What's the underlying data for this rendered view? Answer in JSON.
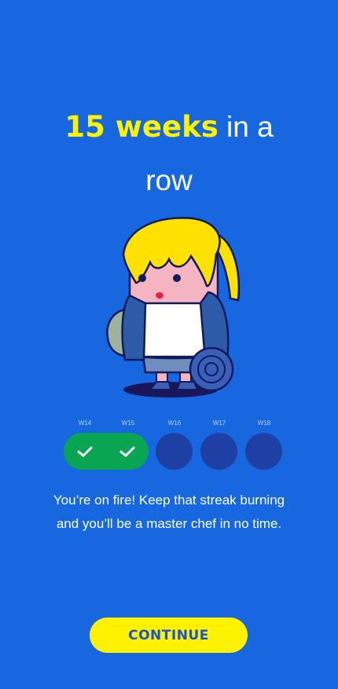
{
  "headline": {
    "highlight": "15 weeks",
    "rest": " in a",
    "line2": "row"
  },
  "illustration": {
    "icon": "character-with-rolled-mat-illustration"
  },
  "weeks": [
    {
      "label": "W14",
      "completed": true
    },
    {
      "label": "W15",
      "completed": true
    },
    {
      "label": "W16",
      "completed": false
    },
    {
      "label": "W17",
      "completed": false
    },
    {
      "label": "W18",
      "completed": false
    }
  ],
  "message": {
    "line1": "You’re on fire! Keep that streak burning",
    "line2": "and you’ll be a master chef in no time."
  },
  "continue_button": {
    "label": "CONTINUE"
  },
  "colors": {
    "background": "#1768e0",
    "accent_yellow": "#fff200",
    "streak_green": "#0aa553",
    "empty_dot": "#1e3fa4"
  }
}
